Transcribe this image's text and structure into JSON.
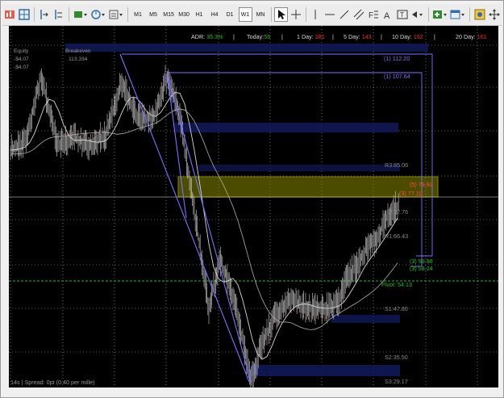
{
  "toolbar": {
    "timeframes": [
      "M1",
      "M5",
      "M15",
      "M30",
      "H1",
      "H4",
      "D1",
      "W1",
      "MN"
    ],
    "active_timeframe": "W1"
  },
  "stats": {
    "adr_label": "ADR:",
    "adr_value": "35.3%",
    "today_label": "Today:",
    "today_value": "55",
    "day1_label": "1 Day:",
    "day1_value": "281",
    "day5_label": "5 Day:",
    "day5_value": "143",
    "day10_label": "10 Day:",
    "day10_value": "152",
    "day20_label": "20 Day:",
    "day20_value": "161"
  },
  "equity_panel": {
    "equity_label": "Equity",
    "breakeven_label": "Breakeven",
    "equity_value_1": "-$4.07",
    "breakeven_value": "113.334",
    "equity_value_2": "-$4.07"
  },
  "fib_labels": {
    "f1": "(1) 112.20",
    "f2": "(1) 107.64",
    "f3": "(5) 79.92",
    "f4": "(3) 77.10",
    "f5": "(3) 59.98",
    "f6": "(3) 58.24"
  },
  "levels": {
    "r3": "R3:85.06",
    "r2": "R2:72.76",
    "r1": "R1:66.43",
    "pivot": "Pivot: 54.13",
    "s1": "S1:47.80",
    "s2": "S2:35.50",
    "s3": "S3:29.17"
  },
  "footer": {
    "status": "14s | Spread: 0pt (0.40 per mille)"
  },
  "colors": {
    "background": "#000000",
    "grid": "#ffffff",
    "price": "#c8c8c8",
    "fib": "#7a72ff",
    "zone": "#d7d700",
    "pivot": "#19c319",
    "level_text": "#8a8a8a",
    "band": "#101a5a"
  }
}
